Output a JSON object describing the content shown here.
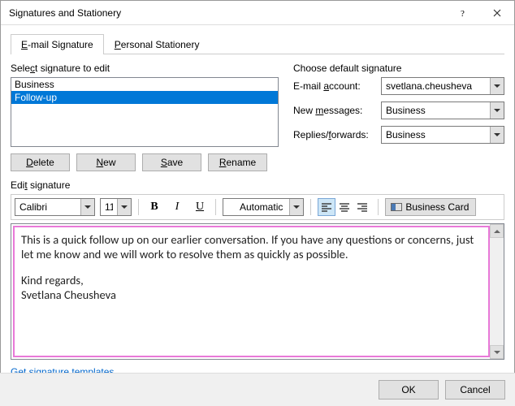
{
  "window": {
    "title": "Signatures and Stationery"
  },
  "tabs": {
    "email_sig": "E-mail Signature",
    "personal_stationery": "Personal Stationery"
  },
  "select_section": {
    "label": "Select signature to edit",
    "items": [
      "Business",
      "Follow-up"
    ],
    "selected_index": 1
  },
  "buttons": {
    "delete": "Delete",
    "new": "New",
    "save": "Save",
    "rename": "Rename",
    "ok": "OK",
    "cancel": "Cancel"
  },
  "defaults": {
    "label": "Choose default signature",
    "account_label": "E-mail account:",
    "account_value": "svetlana.cheusheva",
    "newmsg_label": "New messages:",
    "newmsg_value": "Business",
    "replies_label": "Replies/forwards:",
    "replies_value": "Business"
  },
  "edit": {
    "label": "Edit signature",
    "font": "Calibri",
    "size": "11",
    "color_label": "Automatic",
    "bizcard": "Business Card",
    "body_line1": "This is a quick follow up on our earlier conversation. If you have any questions or concerns, just let me know and we will work to resolve them as quickly as possible.",
    "body_line2": "Kind regards,",
    "body_line3": "Svetlana Cheusheva"
  },
  "link": "Get signature templates"
}
